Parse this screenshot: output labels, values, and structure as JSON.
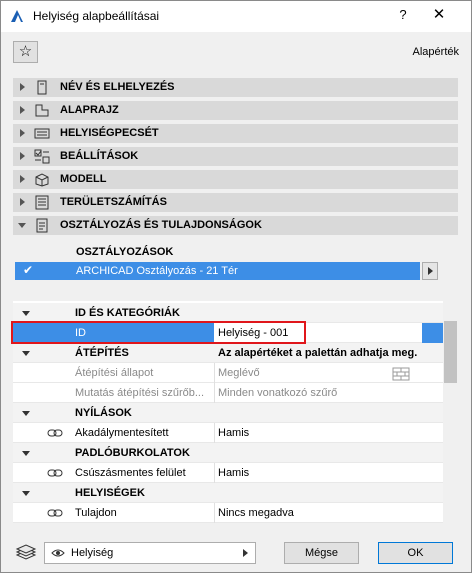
{
  "window": {
    "title": "Helyiség alapbeállításai",
    "help_label": "?",
    "close_label": "✕"
  },
  "toolbar": {
    "favorites_icon": "star-icon",
    "preset_label": "Alapérték"
  },
  "panels": [
    {
      "label": "NÉV ÉS ELHELYEZÉS",
      "icon": "name-position-icon",
      "expanded": false
    },
    {
      "label": "ALAPRAJZ",
      "icon": "floor-plan-icon",
      "expanded": false
    },
    {
      "label": "HELYISÉGPECSÉT",
      "icon": "zone-stamp-icon",
      "expanded": false
    },
    {
      "label": "BEÁLLÍTÁSOK",
      "icon": "settings-icon",
      "expanded": false
    },
    {
      "label": "MODELL",
      "icon": "model-icon",
      "expanded": false
    },
    {
      "label": "TERÜLETSZÁMÍTÁS",
      "icon": "area-calculation-icon",
      "expanded": false
    },
    {
      "label": "OSZTÁLYOZÁS ÉS TULAJDONSÁGOK",
      "icon": "classification-icon",
      "expanded": true
    }
  ],
  "classification": {
    "header": "OSZTÁLYOZÁSOK",
    "row_text": "ARCHICAD Osztályozás - 21 Tér",
    "checked": true
  },
  "properties": {
    "rows": [
      {
        "type": "group",
        "name": "ID ÉS KATEGÓRIÁK",
        "value": ""
      },
      {
        "type": "prop",
        "name": "ID",
        "value": "Helyiség - 001",
        "selected": true
      },
      {
        "type": "group",
        "name": "ÁTÉPÍTÉS",
        "value": "Az alapértéket a palettán adhatja meg."
      },
      {
        "type": "prop",
        "name": "Átépítési állapot",
        "value": "Meglévő",
        "muted": true
      },
      {
        "type": "prop",
        "name": "Mutatás átépítési szűrőb...",
        "value": "Minden vonatkozó szűrő",
        "muted": true
      },
      {
        "type": "group",
        "name": "NYÍLÁSOK",
        "value": ""
      },
      {
        "type": "prop",
        "name": "Akadálymentesített",
        "value": "Hamis",
        "linked": true
      },
      {
        "type": "group",
        "name": "PADLÓBURKOLATOK",
        "value": ""
      },
      {
        "type": "prop",
        "name": "Csúszásmentes felület",
        "value": "Hamis",
        "linked": true
      },
      {
        "type": "group",
        "name": "HELYISÉGEK",
        "value": ""
      },
      {
        "type": "prop",
        "name": "Tulajdon",
        "value": "Nincs megadva",
        "linked": true
      }
    ]
  },
  "footer": {
    "layer_value": "Helyiség",
    "cancel_label": "Mégse",
    "ok_label": "OK"
  },
  "colors": {
    "selection": "#3d8ee6",
    "highlight_box": "#e0161b"
  }
}
